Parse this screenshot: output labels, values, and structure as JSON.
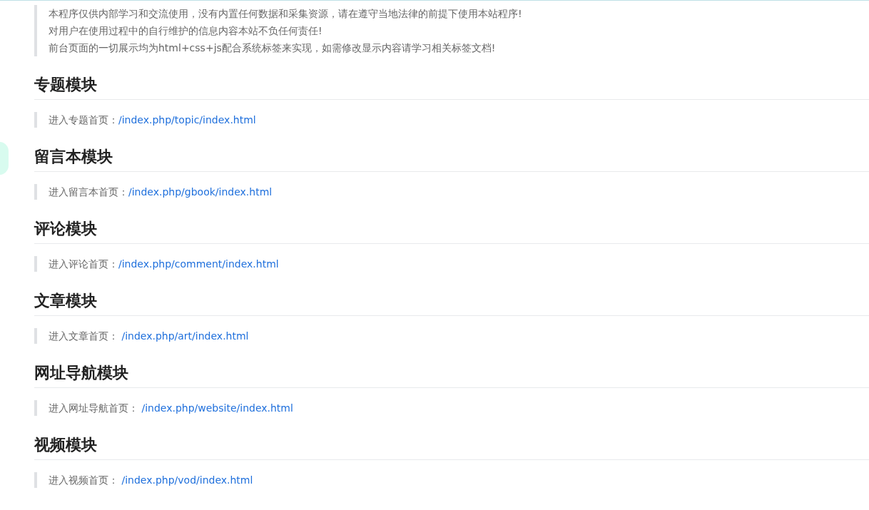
{
  "notice": {
    "lines": [
      "本程序仅供内部学习和交流使用，没有内置任何数据和采集资源，请在遵守当地法律的前提下使用本站程序!",
      "对用户在使用过程中的自行维护的信息内容本站不负任何责任!",
      "前台页面的一切展示均为html+css+js配合系统标签来实现，如需修改显示内容请学习相关标签文档!"
    ]
  },
  "sections": [
    {
      "title": "专题模块",
      "label": "进入专题首页：",
      "link": "/index.php/topic/index.html"
    },
    {
      "title": "留言本模块",
      "label": "进入留言本首页：",
      "link": "/index.php/gbook/index.html"
    },
    {
      "title": "评论模块",
      "label": "进入评论首页：",
      "link": "/index.php/comment/index.html"
    },
    {
      "title": "文章模块",
      "label": "进入文章首页： ",
      "link": "/index.php/art/index.html"
    },
    {
      "title": "网址导航模块",
      "label": "进入网址导航首页： ",
      "link": "/index.php/website/index.html"
    },
    {
      "title": "视频模块",
      "label": "进入视频首页： ",
      "link": "/index.php/vod/index.html"
    }
  ]
}
